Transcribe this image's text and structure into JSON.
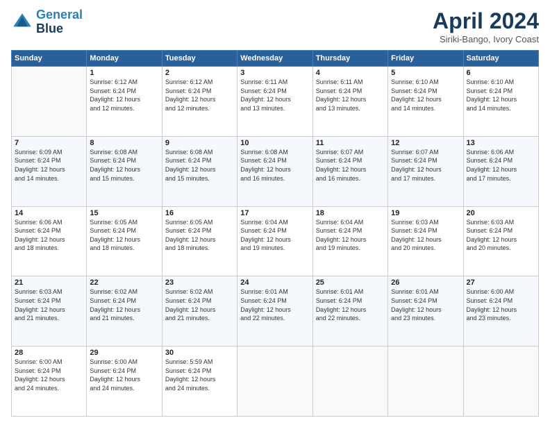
{
  "logo": {
    "line1": "General",
    "line2": "Blue"
  },
  "title": "April 2024",
  "location": "Siriki-Bango, Ivory Coast",
  "days_of_week": [
    "Sunday",
    "Monday",
    "Tuesday",
    "Wednesday",
    "Thursday",
    "Friday",
    "Saturday"
  ],
  "weeks": [
    [
      {
        "day": "",
        "info": ""
      },
      {
        "day": "1",
        "info": "Sunrise: 6:12 AM\nSunset: 6:24 PM\nDaylight: 12 hours\nand 12 minutes."
      },
      {
        "day": "2",
        "info": "Sunrise: 6:12 AM\nSunset: 6:24 PM\nDaylight: 12 hours\nand 12 minutes."
      },
      {
        "day": "3",
        "info": "Sunrise: 6:11 AM\nSunset: 6:24 PM\nDaylight: 12 hours\nand 13 minutes."
      },
      {
        "day": "4",
        "info": "Sunrise: 6:11 AM\nSunset: 6:24 PM\nDaylight: 12 hours\nand 13 minutes."
      },
      {
        "day": "5",
        "info": "Sunrise: 6:10 AM\nSunset: 6:24 PM\nDaylight: 12 hours\nand 14 minutes."
      },
      {
        "day": "6",
        "info": "Sunrise: 6:10 AM\nSunset: 6:24 PM\nDaylight: 12 hours\nand 14 minutes."
      }
    ],
    [
      {
        "day": "7",
        "info": "Sunrise: 6:09 AM\nSunset: 6:24 PM\nDaylight: 12 hours\nand 14 minutes."
      },
      {
        "day": "8",
        "info": "Sunrise: 6:08 AM\nSunset: 6:24 PM\nDaylight: 12 hours\nand 15 minutes."
      },
      {
        "day": "9",
        "info": "Sunrise: 6:08 AM\nSunset: 6:24 PM\nDaylight: 12 hours\nand 15 minutes."
      },
      {
        "day": "10",
        "info": "Sunrise: 6:08 AM\nSunset: 6:24 PM\nDaylight: 12 hours\nand 16 minutes."
      },
      {
        "day": "11",
        "info": "Sunrise: 6:07 AM\nSunset: 6:24 PM\nDaylight: 12 hours\nand 16 minutes."
      },
      {
        "day": "12",
        "info": "Sunrise: 6:07 AM\nSunset: 6:24 PM\nDaylight: 12 hours\nand 17 minutes."
      },
      {
        "day": "13",
        "info": "Sunrise: 6:06 AM\nSunset: 6:24 PM\nDaylight: 12 hours\nand 17 minutes."
      }
    ],
    [
      {
        "day": "14",
        "info": "Sunrise: 6:06 AM\nSunset: 6:24 PM\nDaylight: 12 hours\nand 18 minutes."
      },
      {
        "day": "15",
        "info": "Sunrise: 6:05 AM\nSunset: 6:24 PM\nDaylight: 12 hours\nand 18 minutes."
      },
      {
        "day": "16",
        "info": "Sunrise: 6:05 AM\nSunset: 6:24 PM\nDaylight: 12 hours\nand 18 minutes."
      },
      {
        "day": "17",
        "info": "Sunrise: 6:04 AM\nSunset: 6:24 PM\nDaylight: 12 hours\nand 19 minutes."
      },
      {
        "day": "18",
        "info": "Sunrise: 6:04 AM\nSunset: 6:24 PM\nDaylight: 12 hours\nand 19 minutes."
      },
      {
        "day": "19",
        "info": "Sunrise: 6:03 AM\nSunset: 6:24 PM\nDaylight: 12 hours\nand 20 minutes."
      },
      {
        "day": "20",
        "info": "Sunrise: 6:03 AM\nSunset: 6:24 PM\nDaylight: 12 hours\nand 20 minutes."
      }
    ],
    [
      {
        "day": "21",
        "info": "Sunrise: 6:03 AM\nSunset: 6:24 PM\nDaylight: 12 hours\nand 21 minutes."
      },
      {
        "day": "22",
        "info": "Sunrise: 6:02 AM\nSunset: 6:24 PM\nDaylight: 12 hours\nand 21 minutes."
      },
      {
        "day": "23",
        "info": "Sunrise: 6:02 AM\nSunset: 6:24 PM\nDaylight: 12 hours\nand 21 minutes."
      },
      {
        "day": "24",
        "info": "Sunrise: 6:01 AM\nSunset: 6:24 PM\nDaylight: 12 hours\nand 22 minutes."
      },
      {
        "day": "25",
        "info": "Sunrise: 6:01 AM\nSunset: 6:24 PM\nDaylight: 12 hours\nand 22 minutes."
      },
      {
        "day": "26",
        "info": "Sunrise: 6:01 AM\nSunset: 6:24 PM\nDaylight: 12 hours\nand 23 minutes."
      },
      {
        "day": "27",
        "info": "Sunrise: 6:00 AM\nSunset: 6:24 PM\nDaylight: 12 hours\nand 23 minutes."
      }
    ],
    [
      {
        "day": "28",
        "info": "Sunrise: 6:00 AM\nSunset: 6:24 PM\nDaylight: 12 hours\nand 24 minutes."
      },
      {
        "day": "29",
        "info": "Sunrise: 6:00 AM\nSunset: 6:24 PM\nDaylight: 12 hours\nand 24 minutes."
      },
      {
        "day": "30",
        "info": "Sunrise: 5:59 AM\nSunset: 6:24 PM\nDaylight: 12 hours\nand 24 minutes."
      },
      {
        "day": "",
        "info": ""
      },
      {
        "day": "",
        "info": ""
      },
      {
        "day": "",
        "info": ""
      },
      {
        "day": "",
        "info": ""
      }
    ]
  ]
}
